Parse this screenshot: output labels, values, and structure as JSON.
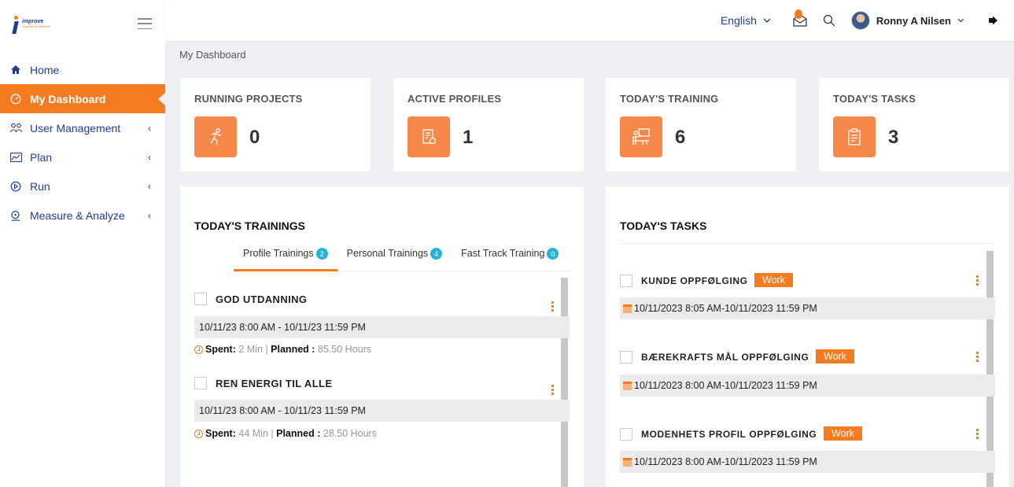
{
  "brand": {
    "logo_text": "improve",
    "logo_sub": "Lead the Excellence"
  },
  "sidebar": {
    "items": [
      {
        "label": "Home",
        "icon": "home-icon"
      },
      {
        "label": "My Dashboard",
        "icon": "dashboard-icon",
        "active": true
      },
      {
        "label": "User Management",
        "icon": "users-icon"
      },
      {
        "label": "Plan",
        "icon": "plan-icon"
      },
      {
        "label": "Run",
        "icon": "run-icon"
      },
      {
        "label": "Measure & Analyze",
        "icon": "measure-icon"
      }
    ]
  },
  "topbar": {
    "language": "English",
    "user_name": "Ronny A Nilsen"
  },
  "breadcrumb": "My Dashboard",
  "stats": [
    {
      "title": "RUNNING PROJECTS",
      "value": "0",
      "icon": "running-icon"
    },
    {
      "title": "ACTIVE PROFILES",
      "value": "1",
      "icon": "profile-icon"
    },
    {
      "title": "TODAY'S TRAINING",
      "value": "6",
      "icon": "training-icon"
    },
    {
      "title": "TODAY'S TASKS",
      "value": "3",
      "icon": "tasks-icon"
    }
  ],
  "trainings": {
    "title": "TODAY'S TRAININGS",
    "tabs": [
      {
        "label": "Profile Trainings",
        "count": "2"
      },
      {
        "label": "Personal Trainings",
        "count": "4"
      },
      {
        "label": "Fast Track Training",
        "count": "0"
      }
    ],
    "items": [
      {
        "title": "GOD UTDANNING",
        "date": "10/11/23 8:00 AM - 10/11/23 11:59 PM",
        "spent_label": "Spent:",
        "spent": "2 Min",
        "sep": "|",
        "planned_label": "Planned :",
        "planned": "85.50 Hours"
      },
      {
        "title": "REN ENERGI TIL ALLE",
        "date": "10/11/23 8:00 AM - 10/11/23 11:59 PM",
        "spent_label": "Spent:",
        "spent": "44 Min",
        "sep": "|",
        "planned_label": "Planned :",
        "planned": "28.50 Hours"
      }
    ]
  },
  "tasks": {
    "title": "TODAY'S TASKS",
    "items": [
      {
        "title": "KUNDE OPPFØLGING",
        "tag": "Work",
        "date": "10/11/2023 8:05 AM-10/11/2023 11:59 PM"
      },
      {
        "title": "BÆREKRAFTS MÅL OPPFØLGING",
        "tag": "Work",
        "date": "10/11/2023 8:00 AM-10/11/2023 11:59 PM"
      },
      {
        "title": "MODENHETS PROFIL OPPFØLGING",
        "tag": "Work",
        "date": "10/11/2023 8:00 AM-10/11/2023 11:59 PM"
      }
    ]
  },
  "colors": {
    "accent": "#f47b20",
    "brand_blue": "#1c3f94",
    "badge": "#26b4d6"
  }
}
